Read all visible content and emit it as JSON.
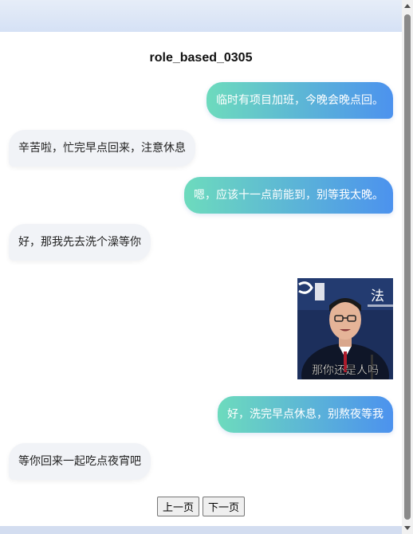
{
  "chat": {
    "title": "role_based_0305",
    "messages": [
      {
        "side": "sent",
        "text": "临时有项目加班，今晚会晚点回。"
      },
      {
        "side": "recv",
        "text": "辛苦啦，忙完早点回来，注意休息"
      },
      {
        "side": "sent",
        "text": "嗯，应该十一点前能到，别等我太晚。"
      },
      {
        "side": "recv",
        "text": "好，那我先去洗个澡等你"
      },
      {
        "side": "sent",
        "type": "sticker",
        "caption": "那你还是人吗",
        "bg_text": "法"
      },
      {
        "side": "sent",
        "text": "好，洗完早点休息，别熬夜等我"
      },
      {
        "side": "recv",
        "text": "等你回来一起吃点夜宵吧"
      }
    ]
  },
  "pager": {
    "prev_label": "上一页",
    "next_label": "下一页"
  },
  "colors": {
    "sent_gradient_start": "#6ddbbd",
    "sent_gradient_end": "#4c92ee",
    "received_bg": "#f1f3f7",
    "page_bg": "#dfe7f5"
  }
}
